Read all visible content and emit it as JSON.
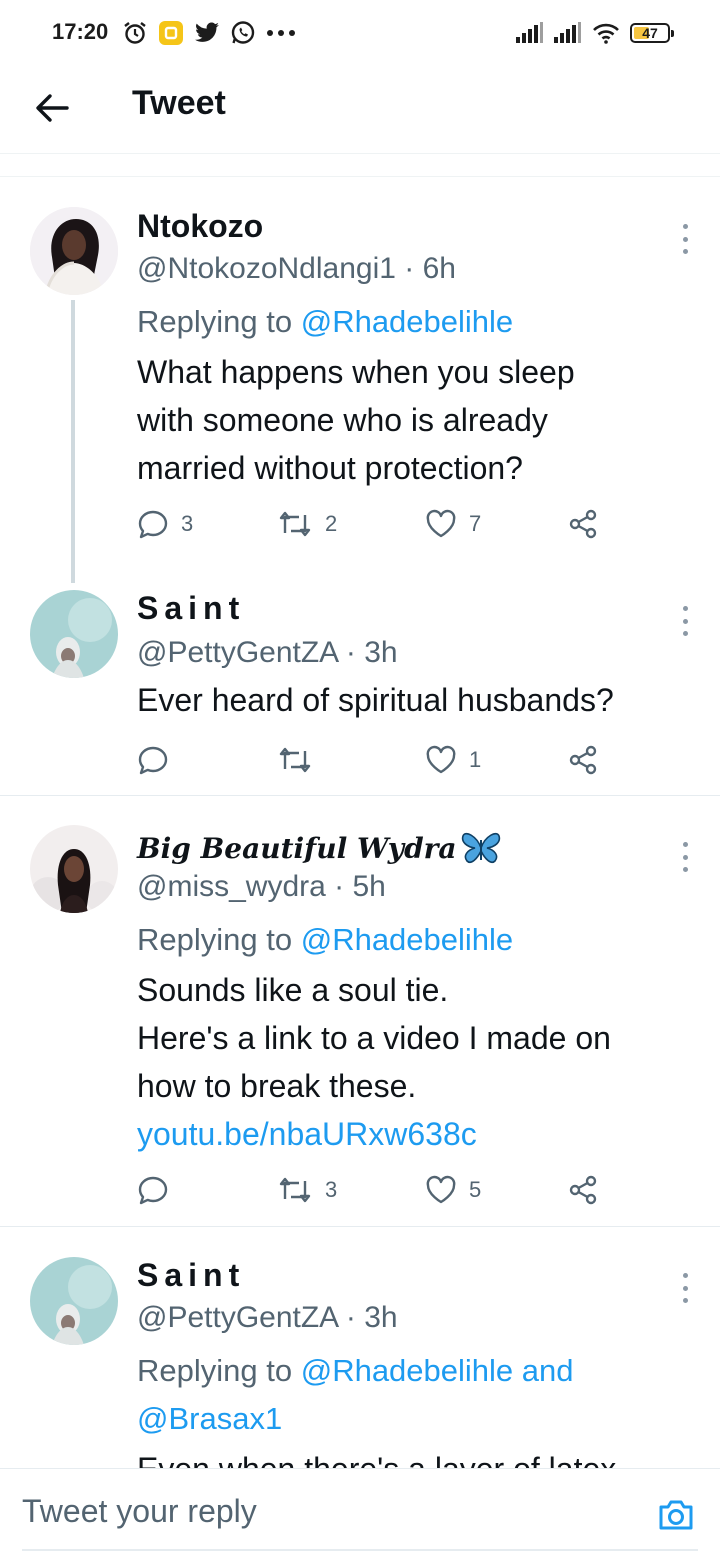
{
  "status_bar": {
    "time": "17:20",
    "battery": "47",
    "battery_level": 0.47
  },
  "header": {
    "title": "Tweet"
  },
  "tweets": [
    {
      "name": "Ntokozo",
      "handle": "@NtokozoNdlangi1 · 6h",
      "replying_prefix": "Replying to ",
      "replying_to": "@Rhadebelihle",
      "text_lines": [
        "What happens when you sleep",
        "with someone who is already",
        "married without protection?"
      ],
      "replies": "3",
      "retweets": "2",
      "likes": "7"
    },
    {
      "name": "Saint",
      "handle": "@PettyGentZA · 3h",
      "text_lines": [
        "Ever heard of spiritual husbands?"
      ],
      "replies": "",
      "retweets": "",
      "likes": "1"
    },
    {
      "name": "Big Beautiful Wydra",
      "handle": "@miss_wydra · 5h",
      "replying_prefix": "Replying to ",
      "replying_to": "@Rhadebelihle",
      "text_lines": [
        "Sounds like a soul tie.",
        "Here's a link to a video I made on",
        "how to break these."
      ],
      "link": "youtu.be/nbaURxw638c",
      "replies": "",
      "retweets": "3",
      "likes": "5"
    },
    {
      "name": "Saint",
      "handle": "@PettyGentZA · 3h",
      "replying_prefix": "Replying to ",
      "replying_to_1": "@Rhadebelihle and",
      "replying_to_2": "@Brasax1",
      "text_partial": "Even when there's a layer of latex"
    }
  ],
  "reply_bar": {
    "placeholder": "Tweet your reply"
  },
  "colors": {
    "link": "#1d9bf0",
    "secondary_text": "#536471",
    "primary_text": "#0f1419",
    "butterfly": "#4aa3df"
  },
  "icons": [
    "back-arrow-icon",
    "reply-icon",
    "retweet-icon",
    "like-icon",
    "share-icon",
    "more-icon",
    "camera-icon",
    "butterfly-icon"
  ]
}
